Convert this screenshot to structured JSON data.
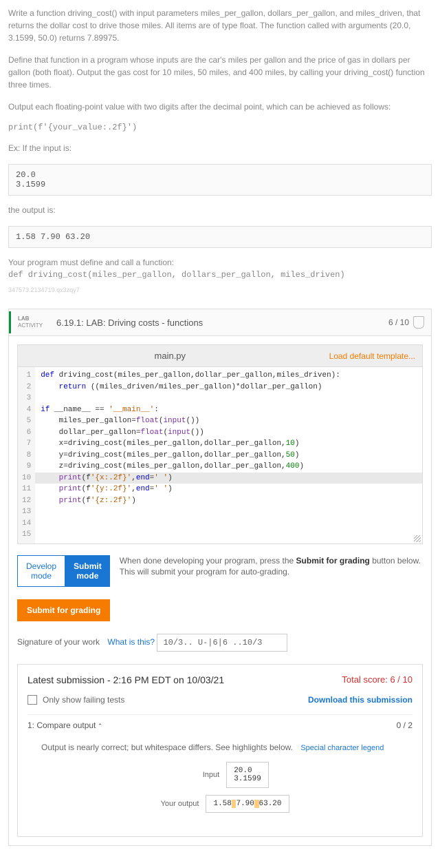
{
  "description": {
    "p1": "Write a function driving_cost() with input parameters miles_per_gallon, dollars_per_gallon, and miles_driven, that returns the dollar cost to drive those miles. All items are of type float. The function called with arguments (20.0, 3.1599, 50.0) returns 7.89975.",
    "p2": "Define that function in a program whose inputs are the car's miles per gallon and the price of gas in dollars per gallon (both float). Output the gas cost for 10 miles, 50 miles, and 400 miles, by calling your driving_cost() function three times.",
    "p3": "Output each floating-point value with two digits after the decimal point, which can be achieved as follows:",
    "print_example": "print(f'{your_value:.2f}')",
    "ex_label": "Ex: If the input is:",
    "input_example": "20.0\n3.1599",
    "output_label": "the output is:",
    "output_example": "1.58 7.90 63.20",
    "p4": "Your program must define and call a function:",
    "def_example": "def driving_cost(miles_per_gallon, dollars_per_gallon, miles_driven)",
    "id_string": "347573.2134719.qx3zqy7"
  },
  "lab": {
    "activity_line1": "LAB",
    "activity_line2": "ACTIVITY",
    "title": "6.19.1: LAB: Driving costs - functions",
    "score": "6 / 10"
  },
  "editor": {
    "filename": "main.py",
    "load_template": "Load default template...",
    "line_count": 15,
    "code": "def driving_cost(miles_per_gallon,dollar_per_gallon,miles_driven):\n    return ((miles_driven/miles_per_gallon)*dollar_per_gallon)\n\nif __name__ == '__main__':\n    miles_per_gallon=float(input())\n    dollar_per_gallon=float(input())\n    x=driving_cost(miles_per_gallon,dollar_per_gallon,10)\n    y=driving_cost(miles_per_gallon,dollar_per_gallon,50)\n    z=driving_cost(miles_per_gallon,dollar_per_gallon,400)\n    print(f'{x:.2f}',end=' ')\n    print(f'{y:.2f}',end=' ')\n    print(f'{z:.2f}')\n\n\n"
  },
  "mode": {
    "develop": "Develop mode",
    "submit": "Submit mode",
    "desc_prefix": "When done developing your program, press the ",
    "desc_bold": "Submit for grading",
    "desc_suffix": " button below. This will submit your program for auto-grading.",
    "grading_button": "Submit for grading"
  },
  "signature": {
    "label": "Signature of your work",
    "what": "What is this?",
    "value": "10/3.. U-|6|6 ..10/3"
  },
  "results": {
    "latest": "Latest submission - 2:16 PM EDT on 10/03/21",
    "total_score": "Total score: 6 / 10",
    "only_failing": "Only show failing tests",
    "download": "Download this submission",
    "test1_name": "1: Compare output",
    "test1_score": "0 / 2",
    "test1_msg": "Output is nearly correct; but whitespace differs. See highlights below.",
    "legend": "Special character legend",
    "input_label": "Input",
    "input_value": "20.0\n3.1599",
    "your_output_label": "Your output",
    "your_output_parts": [
      "1.58",
      " ",
      "7.90",
      " ",
      "63.20"
    ]
  }
}
